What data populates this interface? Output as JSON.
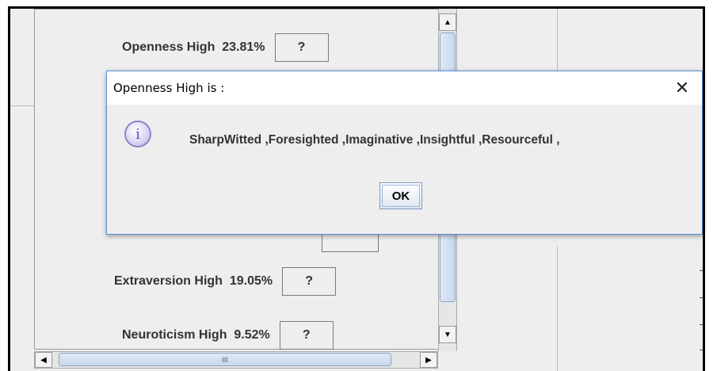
{
  "traits": [
    {
      "name": "Openness High",
      "percent": "23.81%",
      "button": "?"
    },
    {
      "name": "Extraversion High",
      "percent": "19.05%",
      "button": "?"
    },
    {
      "name": "Neuroticism High",
      "percent": "9.52%",
      "button": "?"
    }
  ],
  "scrollbar": {
    "up_icon": "triangle-up-icon",
    "down_icon": "triangle-down-icon",
    "left_icon": "triangle-left-icon",
    "right_icon": "triangle-right-icon",
    "grip": "III"
  },
  "dialog": {
    "title": "Openness High is :",
    "close_glyph": "✕",
    "icon": "info-icon",
    "message": "SharpWitted ,Foresighted ,Imaginative ,Insightful ,Resourceful ,",
    "ok_label": "OK"
  },
  "colors": {
    "dialog_border": "#5b8fd6",
    "background": "#eeeeee"
  }
}
